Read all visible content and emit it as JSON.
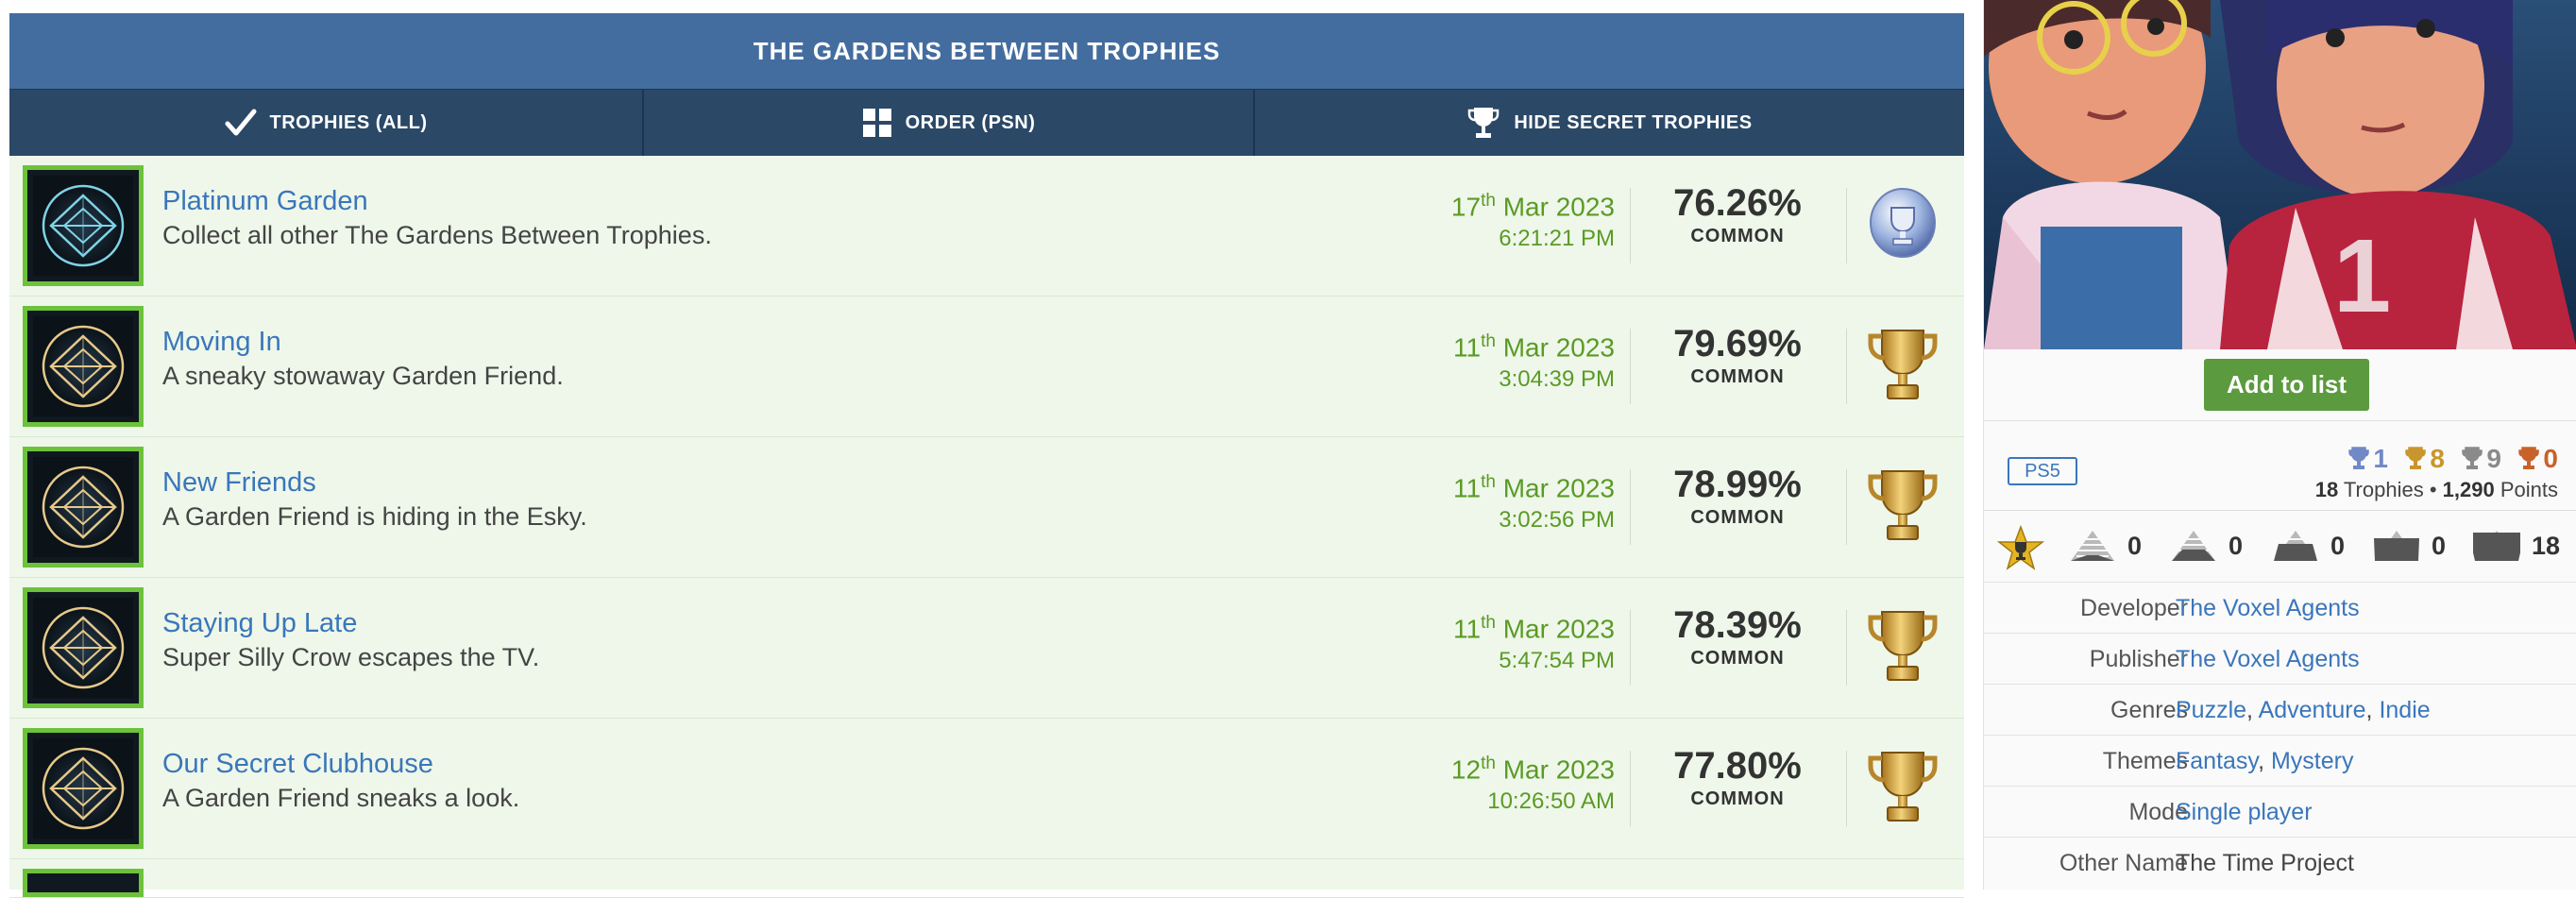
{
  "header": {
    "title": "THE GARDENS BETWEEN TROPHIES",
    "tabs": [
      {
        "label": "TROPHIES (ALL)",
        "icon": "checkmark-icon"
      },
      {
        "label": "ORDER (PSN)",
        "icon": "grid-icon"
      },
      {
        "label": "HIDE SECRET TROPHIES",
        "icon": "trophy-icon"
      }
    ]
  },
  "trophies": [
    {
      "name": "Platinum Garden",
      "description": "Collect all other The Gardens Between Trophies.",
      "day": "17",
      "ordinal": "th",
      "month_year": "Mar 2023",
      "time": "6:21:21 PM",
      "percent": "76.26%",
      "rarity": "COMMON",
      "type": "platinum"
    },
    {
      "name": "Moving In",
      "description": "A sneaky stowaway Garden Friend.",
      "day": "11",
      "ordinal": "th",
      "month_year": "Mar 2023",
      "time": "3:04:39 PM",
      "percent": "79.69%",
      "rarity": "COMMON",
      "type": "gold"
    },
    {
      "name": "New Friends",
      "description": "A Garden Friend is hiding in the Esky.",
      "day": "11",
      "ordinal": "th",
      "month_year": "Mar 2023",
      "time": "3:02:56 PM",
      "percent": "78.99%",
      "rarity": "COMMON",
      "type": "gold"
    },
    {
      "name": "Staying Up Late",
      "description": "Super Silly Crow escapes the TV.",
      "day": "11",
      "ordinal": "th",
      "month_year": "Mar 2023",
      "time": "5:47:54 PM",
      "percent": "78.39%",
      "rarity": "COMMON",
      "type": "gold"
    },
    {
      "name": "Our Secret Clubhouse",
      "description": "A Garden Friend sneaks a look.",
      "day": "12",
      "ordinal": "th",
      "month_year": "Mar 2023",
      "time": "10:26:50 AM",
      "percent": "77.80%",
      "rarity": "COMMON",
      "type": "gold"
    }
  ],
  "sidebar": {
    "add_to_list": "Add to list",
    "platform": "PS5",
    "counts": {
      "platinum": "1",
      "gold": "8",
      "silver": "9",
      "bronze": "0"
    },
    "summary": {
      "trophies": "18",
      "trophies_label": "Trophies",
      "bullet": "•",
      "points": "1,290",
      "points_label": "Points"
    },
    "ranks": [
      "0",
      "0",
      "0",
      "0",
      "18"
    ],
    "info": {
      "developer_label": "Developer",
      "developer": "The Voxel Agents",
      "publisher_label": "Publisher",
      "publisher": "The Voxel Agents",
      "genres_label": "Genres",
      "genres": [
        "Puzzle",
        "Adventure",
        "Indie"
      ],
      "themes_label": "Themes",
      "themes": [
        "Fantasy",
        "Mystery"
      ],
      "mode_label": "Mode",
      "mode": "Single player",
      "other_name_label": "Other Name",
      "other_name": "The Time Project"
    }
  },
  "colors": {
    "header_bg": "#446d9f",
    "tab_bg": "#2b4866",
    "row_bg": "#eef7ea",
    "link": "#3a76bb",
    "date_green": "#5b9a25",
    "icon_border": "#6cc23b",
    "platinum": "#7189c6",
    "gold": "#c9962e",
    "silver": "#8a8a8a",
    "bronze": "#c8622a"
  }
}
